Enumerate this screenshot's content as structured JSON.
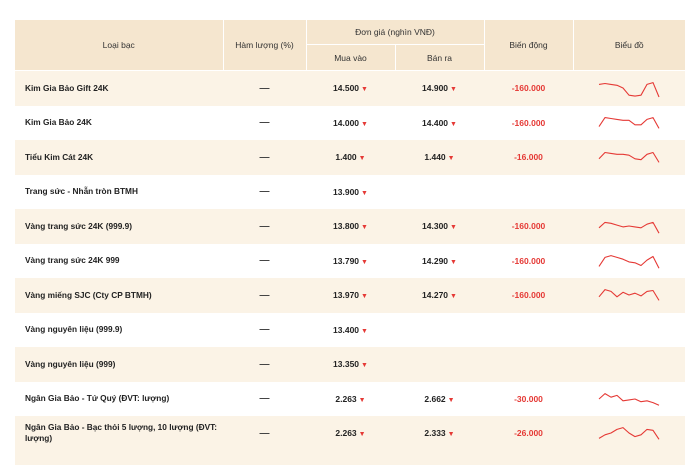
{
  "headers": {
    "type": "Loại bạc",
    "purity": "Hàm lượng (%)",
    "unit_price": "Đơn giá (nghìn VNĐ)",
    "buy": "Mua vào",
    "sell": "Bán ra",
    "change": "Biến động",
    "chart": "Biểu đồ"
  },
  "symbols": {
    "dash": "—",
    "down_arrow": "▼"
  },
  "colors": {
    "header_bg": "#f5e6cf",
    "row_alt_bg": "#fbf3e6",
    "down": "#e53935"
  },
  "rows": [
    {
      "name": "Kim Gia Bảo Gift 24K",
      "purity": "—",
      "buy": "14.500",
      "sell": "14.900",
      "change": "-160.000",
      "spark": [
        0.3,
        0.25,
        0.3,
        0.35,
        0.5,
        0.9,
        0.95,
        0.9,
        0.3,
        0.2,
        1.0
      ]
    },
    {
      "name": "Kim Gia Bảo 24K",
      "purity": "—",
      "buy": "14.000",
      "sell": "14.400",
      "change": "-160.000",
      "spark": [
        0.7,
        0.2,
        0.25,
        0.3,
        0.35,
        0.35,
        0.6,
        0.6,
        0.3,
        0.2,
        0.8
      ]
    },
    {
      "name": "Tiểu Kim Cát 24K",
      "purity": "—",
      "buy": "1.400",
      "sell": "1.440",
      "change": "-16.000",
      "spark": [
        0.6,
        0.25,
        0.3,
        0.35,
        0.35,
        0.4,
        0.6,
        0.65,
        0.35,
        0.25,
        0.8
      ]
    },
    {
      "name": "Trang sức - Nhẫn tròn BTMH",
      "purity": "—",
      "buy": "13.900",
      "sell": "",
      "change": "",
      "spark": null
    },
    {
      "name": "Vàng trang sức 24K (999.9)",
      "purity": "—",
      "buy": "13.800",
      "sell": "14.300",
      "change": "-160.000",
      "spark": [
        0.6,
        0.3,
        0.35,
        0.45,
        0.55,
        0.5,
        0.55,
        0.6,
        0.4,
        0.3,
        0.9
      ]
    },
    {
      "name": "Vàng trang sức 24K 999",
      "purity": "—",
      "buy": "13.790",
      "sell": "14.290",
      "change": "-160.000",
      "spark": [
        0.8,
        0.3,
        0.2,
        0.3,
        0.4,
        0.55,
        0.6,
        0.75,
        0.45,
        0.25,
        0.9
      ]
    },
    {
      "name": "Vàng miếng SJC (Cty CP BTMH)",
      "purity": "—",
      "buy": "13.970",
      "sell": "14.270",
      "change": "-160.000",
      "spark": [
        0.6,
        0.2,
        0.3,
        0.6,
        0.35,
        0.5,
        0.4,
        0.55,
        0.3,
        0.25,
        0.8
      ]
    },
    {
      "name": "Vàng nguyên liệu (999.9)",
      "purity": "—",
      "buy": "13.400",
      "sell": "",
      "change": "",
      "spark": null
    },
    {
      "name": "Vàng nguyên liệu (999)",
      "purity": "—",
      "buy": "13.350",
      "sell": "",
      "change": "",
      "spark": null
    },
    {
      "name": "Ngân Gia Bảo - Tứ Quý (ĐVT: lượng)",
      "purity": "—",
      "buy": "2.263",
      "sell": "2.662",
      "change": "-30.000",
      "spark": [
        0.5,
        0.2,
        0.4,
        0.3,
        0.6,
        0.55,
        0.5,
        0.65,
        0.6,
        0.7,
        0.85
      ]
    },
    {
      "name": "Ngân Gia Bảo - Bạc thỏi 5 lượng, 10 lượng (ĐVT: lượng)",
      "purity": "—",
      "buy": "2.263",
      "sell": "2.333",
      "change": "-26.000",
      "spark": [
        0.8,
        0.6,
        0.5,
        0.3,
        0.2,
        0.5,
        0.7,
        0.6,
        0.3,
        0.35,
        0.85
      ]
    }
  ]
}
